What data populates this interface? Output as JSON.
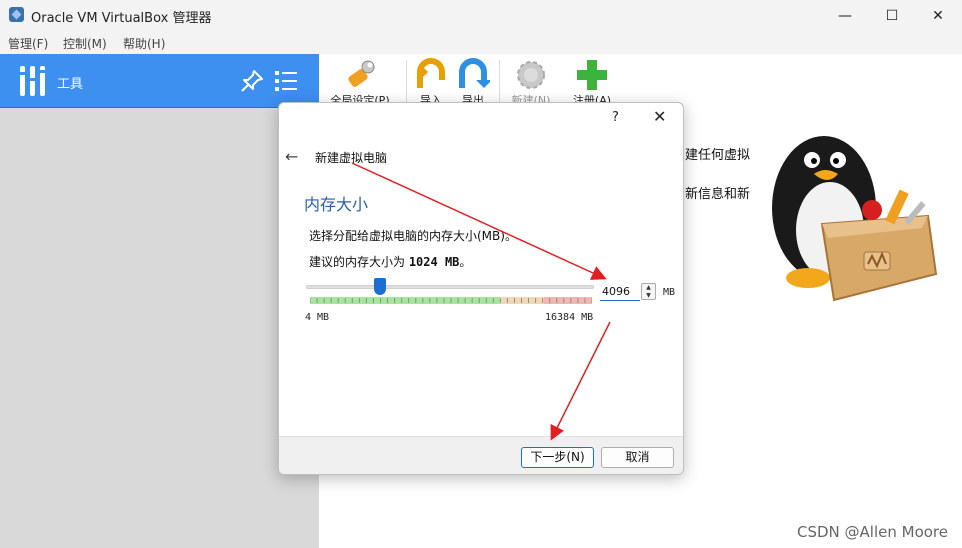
{
  "window": {
    "title": "Oracle VM VirtualBox 管理器",
    "minimize": "—",
    "maximize": "☐",
    "close": "✕"
  },
  "menu": [
    "管理(F)",
    "控制(M)",
    "帮助(H)"
  ],
  "sidebar": {
    "tools_label": "工具",
    "icons": [
      "tools-icon",
      "pin-icon",
      "list-icon"
    ]
  },
  "toolbar": {
    "settings": "全局设定(P)",
    "import": "导入",
    "export": "导出",
    "new": "新建(N)",
    "register": "注册(A)"
  },
  "welcome": {
    "line1": "建任何虚拟",
    "line2": "新信息和新"
  },
  "dialog": {
    "help": "?",
    "close": "✕",
    "wizard_title": "新建虚拟电脑",
    "heading": "内存大小",
    "description": "选择分配给虚拟电脑的内存大小(MB)。",
    "recommend_prefix": "建议的内存大小为 ",
    "recommend_value": "1024 MB",
    "recommend_suffix": "。",
    "slider": {
      "value": 4096,
      "min_label": "4 MB",
      "max_label": "16384 MB",
      "min": 4,
      "max": 16384
    },
    "memory_value": "4096",
    "unit": "MB",
    "next_button": "下一步(N)",
    "cancel_button": "取消"
  },
  "watermark": "CSDN @Allen Moore",
  "colors": {
    "accent": "#3d8ff0",
    "arrow": "#e02020",
    "heading": "#2a5db0"
  }
}
